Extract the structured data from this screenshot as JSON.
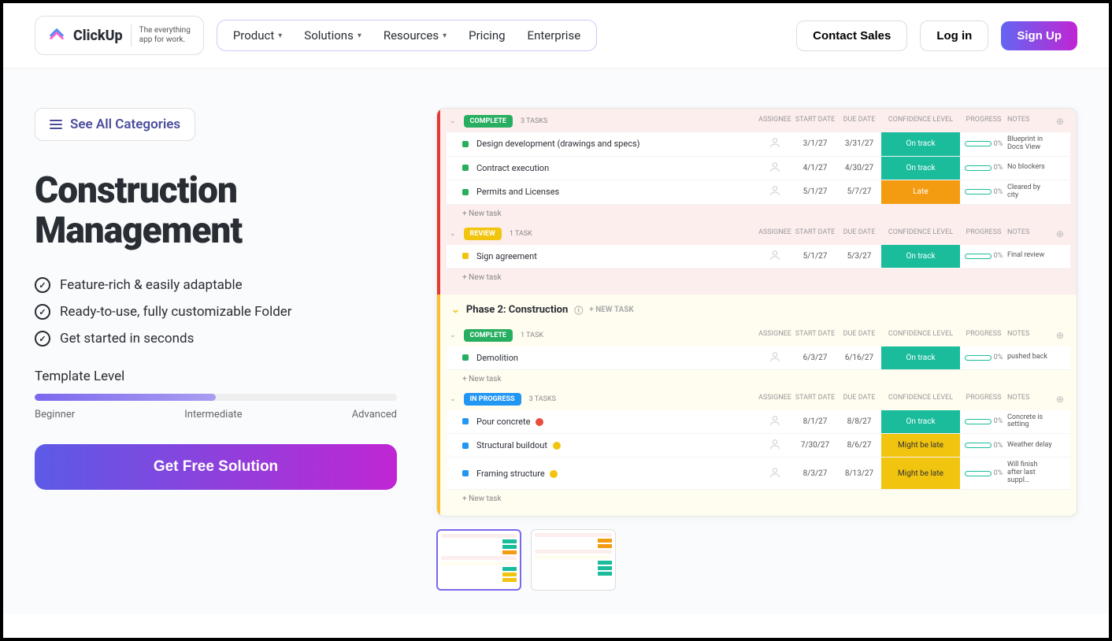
{
  "header": {
    "brand": "ClickUp",
    "tagline1": "The everything",
    "tagline2": "app for work.",
    "nav": {
      "product": "Product",
      "solutions": "Solutions",
      "resources": "Resources",
      "pricing": "Pricing",
      "enterprise": "Enterprise"
    },
    "contact": "Contact Sales",
    "login": "Log in",
    "signup": "Sign Up"
  },
  "left": {
    "see_all": "See All Categories",
    "title": "Construction Management",
    "features": [
      "Feature-rich & easily adaptable",
      "Ready-to-use, fully customizable Folder",
      "Get started in seconds"
    ],
    "level_label": "Template Level",
    "level_marks": {
      "beginner": "Beginner",
      "intermediate": "Intermediate",
      "advanced": "Advanced"
    },
    "cta": "Get Free Solution"
  },
  "preview": {
    "cols": {
      "assignee": "ASSIGNEE",
      "start": "START DATE",
      "due": "DUE DATE",
      "conf": "CONFIDENCE LEVEL",
      "progress": "PROGRESS",
      "notes": "NOTES"
    },
    "new_task": "+ New task",
    "phase1": {
      "groups": [
        {
          "status": "COMPLETE",
          "pill_class": "green",
          "count": "3 TASKS",
          "tasks": [
            {
              "dot": "dot-green",
              "name": "Design development (drawings and specs)",
              "start": "3/1/27",
              "due": "3/31/27",
              "conf": "On track",
              "conf_class": "conf-ontrack",
              "progress": "0%",
              "notes": "Blueprint in Docs View"
            },
            {
              "dot": "dot-green",
              "name": "Contract execution",
              "start": "4/1/27",
              "due": "4/30/27",
              "conf": "On track",
              "conf_class": "conf-ontrack",
              "progress": "0%",
              "notes": "No blockers"
            },
            {
              "dot": "dot-green",
              "name": "Permits and Licenses",
              "start": "5/1/27",
              "due": "5/7/27",
              "conf": "Late",
              "conf_class": "conf-late",
              "progress": "0%",
              "notes": "Cleared by city"
            }
          ]
        },
        {
          "status": "REVIEW",
          "pill_class": "yellow",
          "count": "1 TASK",
          "tasks": [
            {
              "dot": "dot-yellow",
              "name": "Sign agreement",
              "start": "5/1/27",
              "due": "5/3/27",
              "conf": "On track",
              "conf_class": "conf-ontrack",
              "progress": "0%",
              "notes": "Final review"
            }
          ]
        }
      ]
    },
    "phase2": {
      "title": "Phase 2: Construction",
      "new_task_upper": "+ NEW TASK",
      "groups": [
        {
          "status": "COMPLETE",
          "pill_class": "green",
          "count": "1 TASK",
          "tasks": [
            {
              "dot": "dot-green",
              "name": "Demolition",
              "start": "6/3/27",
              "due": "6/16/27",
              "conf": "On track",
              "conf_class": "conf-ontrack",
              "progress": "0%",
              "notes": "pushed back"
            }
          ]
        },
        {
          "status": "IN PROGRESS",
          "pill_class": "blue",
          "count": "3 TASKS",
          "tasks": [
            {
              "dot": "dot-blue",
              "name": "Pour concrete",
              "flag": "red",
              "start": "8/1/27",
              "due": "8/8/27",
              "conf": "On track",
              "conf_class": "conf-ontrack",
              "progress": "0%",
              "notes": "Concrete is setting"
            },
            {
              "dot": "dot-blue",
              "name": "Structural buildout",
              "flag": "yel",
              "start": "7/30/27",
              "due": "8/6/27",
              "conf": "Might be late",
              "conf_class": "conf-might",
              "progress": "0%",
              "notes": "Weather delay"
            },
            {
              "dot": "dot-blue",
              "name": "Framing structure",
              "flag": "yel",
              "start": "8/3/27",
              "due": "8/13/27",
              "conf": "Might be late",
              "conf_class": "conf-might",
              "progress": "0%",
              "notes": "Will finish after last suppl…"
            }
          ]
        }
      ]
    }
  }
}
